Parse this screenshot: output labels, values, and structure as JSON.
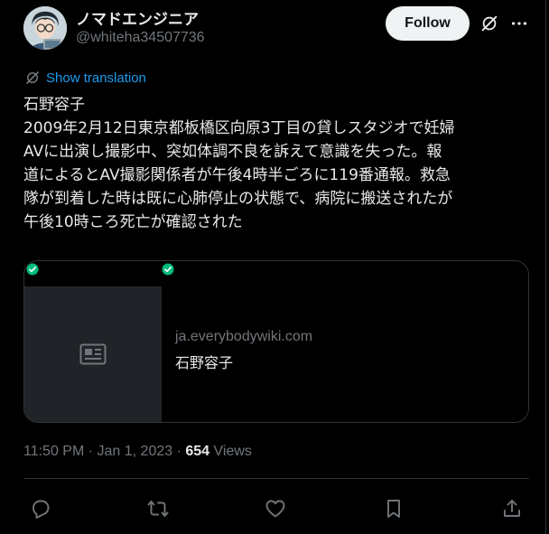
{
  "author": {
    "display_name": "ノマドエンジニア",
    "handle": "@whiteha34507736",
    "avatar_icon": "avatar-illustration"
  },
  "header": {
    "follow_label": "Follow",
    "grok_icon": "grok-icon",
    "more_icon": "more-icon"
  },
  "translate": {
    "label": "Show translation",
    "icon": "translate-icon"
  },
  "tweet": {
    "lines": [
      "石野容子",
      "2009年2月12日東京都板橋区向原3丁目の貸しスタジオで妊婦",
      "AVに出演し撮影中、突如体調不良を訴えて意識を失った。報",
      "道によるとAV撮影関係者が午後4時半ごろに119番通報。救急",
      "隊が到着した時は既に心肺停止の状態で、病院に搬送されたが",
      "午後10時ころ死亡が確認された"
    ]
  },
  "card": {
    "domain": "ja.everybodywiki.com",
    "title": "石野容子",
    "thumbnail_icon": "article-icon"
  },
  "meta": {
    "timestamp": "11:50 PM · Jan 1, 2023 · ",
    "views_count": "654",
    "views_label": " Views"
  },
  "actions": [
    "reply-icon",
    "retweet-icon",
    "like-icon",
    "bookmark-icon",
    "share-icon"
  ],
  "colors": {
    "background": "#000000",
    "text": "#e7e9ea",
    "muted": "#71767b",
    "link": "#1d9bf0",
    "border": "#2f3336",
    "check": "#00ba7c"
  }
}
